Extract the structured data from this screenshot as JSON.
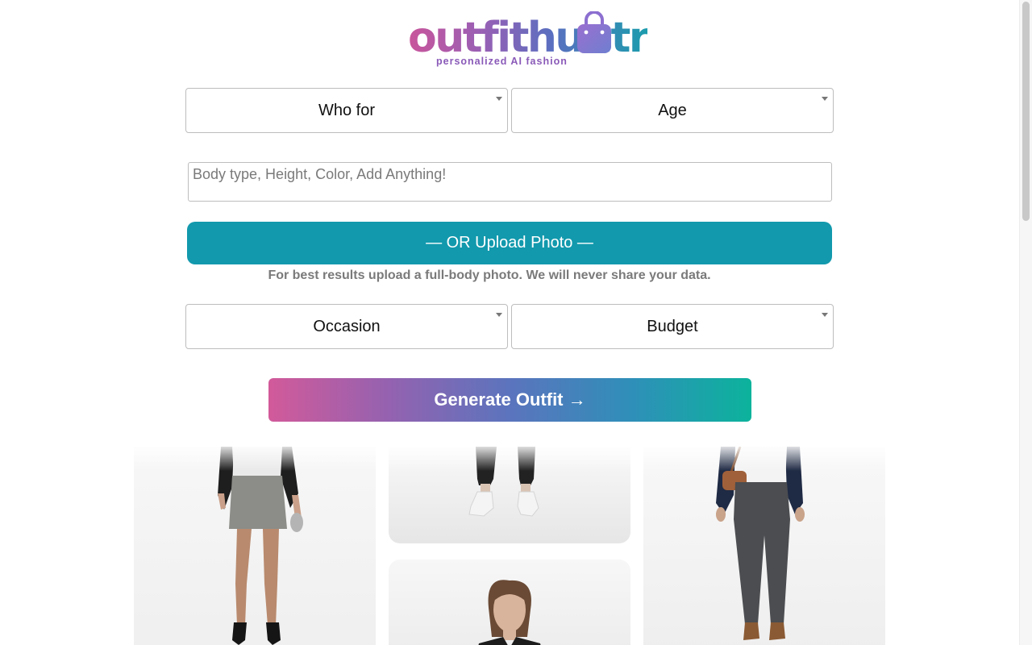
{
  "brand": {
    "logo_text": "outfithuntr",
    "tagline": "personalized AI fashion"
  },
  "form": {
    "who_for": {
      "selected": "Who for"
    },
    "age": {
      "selected": "Age"
    },
    "details": {
      "placeholder": "Body type, Height, Color, Add Anything!",
      "value": ""
    },
    "upload_button": "— OR Upload Photo —",
    "upload_note": "For best results upload a full-body photo. We will never share your data.",
    "occasion": {
      "selected": "Occasion"
    },
    "budget": {
      "selected": "Budget"
    },
    "generate_button": "Generate Outfit →"
  },
  "gallery": {
    "items": [
      {
        "icon": "outfit-photo",
        "description_id": "leather-jacket-skirt"
      },
      {
        "icon": "outfit-photo",
        "description_id": "joggers-sneakers"
      },
      {
        "icon": "outfit-photo",
        "description_id": "woman-leather-jacket"
      },
      {
        "icon": "outfit-photo",
        "description_id": "blazer-trousers"
      }
    ]
  },
  "colors": {
    "primary_teal": "#1299ad",
    "gradient_start": "#d25a9a",
    "gradient_end": "#0cb39c",
    "muted_text": "#7a7a7a"
  }
}
